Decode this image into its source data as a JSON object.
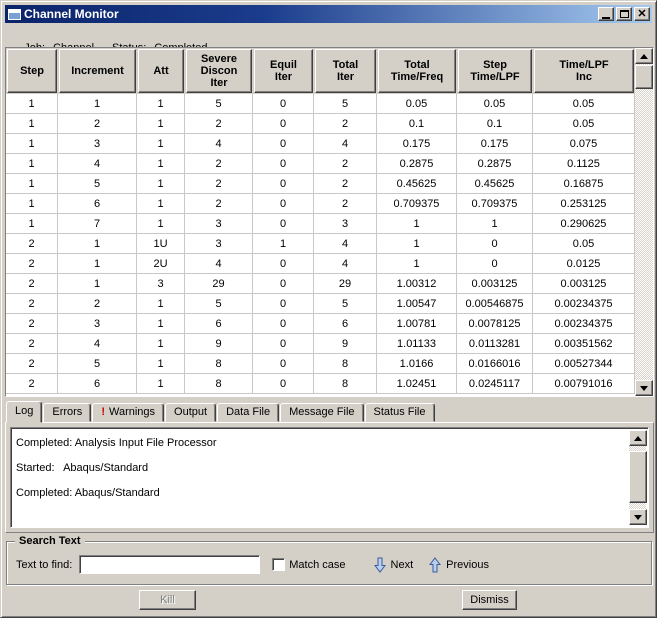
{
  "window": {
    "title": "Channel Monitor"
  },
  "status_line": {
    "job_label": "Job:",
    "job_value": "Channel",
    "status_label": "Status:",
    "status_value": "Completed"
  },
  "table": {
    "columns": [
      "Step",
      "Increment",
      "Att",
      "Severe\nDiscon\nIter",
      "Equil\nIter",
      "Total\nIter",
      "Total\nTime/Freq",
      "Step\nTime/LPF",
      "Time/LPF\nInc"
    ],
    "rows": [
      [
        "1",
        "1",
        "1",
        "5",
        "0",
        "5",
        "0.05",
        "0.05",
        "0.05"
      ],
      [
        "1",
        "2",
        "1",
        "2",
        "0",
        "2",
        "0.1",
        "0.1",
        "0.05"
      ],
      [
        "1",
        "3",
        "1",
        "4",
        "0",
        "4",
        "0.175",
        "0.175",
        "0.075"
      ],
      [
        "1",
        "4",
        "1",
        "2",
        "0",
        "2",
        "0.2875",
        "0.2875",
        "0.1125"
      ],
      [
        "1",
        "5",
        "1",
        "2",
        "0",
        "2",
        "0.45625",
        "0.45625",
        "0.16875"
      ],
      [
        "1",
        "6",
        "1",
        "2",
        "0",
        "2",
        "0.709375",
        "0.709375",
        "0.253125"
      ],
      [
        "1",
        "7",
        "1",
        "3",
        "0",
        "3",
        "1",
        "1",
        "0.290625"
      ],
      [
        "2",
        "1",
        "1U",
        "3",
        "1",
        "4",
        "1",
        "0",
        "0.05"
      ],
      [
        "2",
        "1",
        "2U",
        "4",
        "0",
        "4",
        "1",
        "0",
        "0.0125"
      ],
      [
        "2",
        "1",
        "3",
        "29",
        "0",
        "29",
        "1.00312",
        "0.003125",
        "0.003125"
      ],
      [
        "2",
        "2",
        "1",
        "5",
        "0",
        "5",
        "1.00547",
        "0.00546875",
        "0.00234375"
      ],
      [
        "2",
        "3",
        "1",
        "6",
        "0",
        "6",
        "1.00781",
        "0.0078125",
        "0.00234375"
      ],
      [
        "2",
        "4",
        "1",
        "9",
        "0",
        "9",
        "1.01133",
        "0.0113281",
        "0.00351562"
      ],
      [
        "2",
        "5",
        "1",
        "8",
        "0",
        "8",
        "1.0166",
        "0.0166016",
        "0.00527344"
      ],
      [
        "2",
        "6",
        "1",
        "8",
        "0",
        "8",
        "1.02451",
        "0.0245117",
        "0.00791016"
      ]
    ]
  },
  "tabs": [
    {
      "label": "Log",
      "active": true
    },
    {
      "label": "Errors"
    },
    {
      "label": "Warnings",
      "warning": true,
      "warning_glyph": "!"
    },
    {
      "label": "Output"
    },
    {
      "label": "Data File"
    },
    {
      "label": "Message File"
    },
    {
      "label": "Status File"
    }
  ],
  "log": {
    "lines": [
      "Completed: Analysis Input File Processor",
      "Started:   Abaqus/Standard",
      "Completed: Abaqus/Standard"
    ]
  },
  "search": {
    "group_label": "Search Text",
    "find_label": "Text to find:",
    "find_value": "",
    "match_case_label": "Match case",
    "match_case_checked": false,
    "next_label": "Next",
    "previous_label": "Previous"
  },
  "buttons": {
    "kill": "Kill",
    "dismiss": "Dismiss"
  },
  "colors": {
    "window_bg": "#d4d0c8",
    "titlebar_left": "#0a246a",
    "titlebar_right": "#a6caf0",
    "warning_red": "#cc0000",
    "nav_arrow_fill": "#b8cfee",
    "nav_arrow_stroke": "#3a5a9b",
    "grid_line": "#c8c8c8"
  }
}
